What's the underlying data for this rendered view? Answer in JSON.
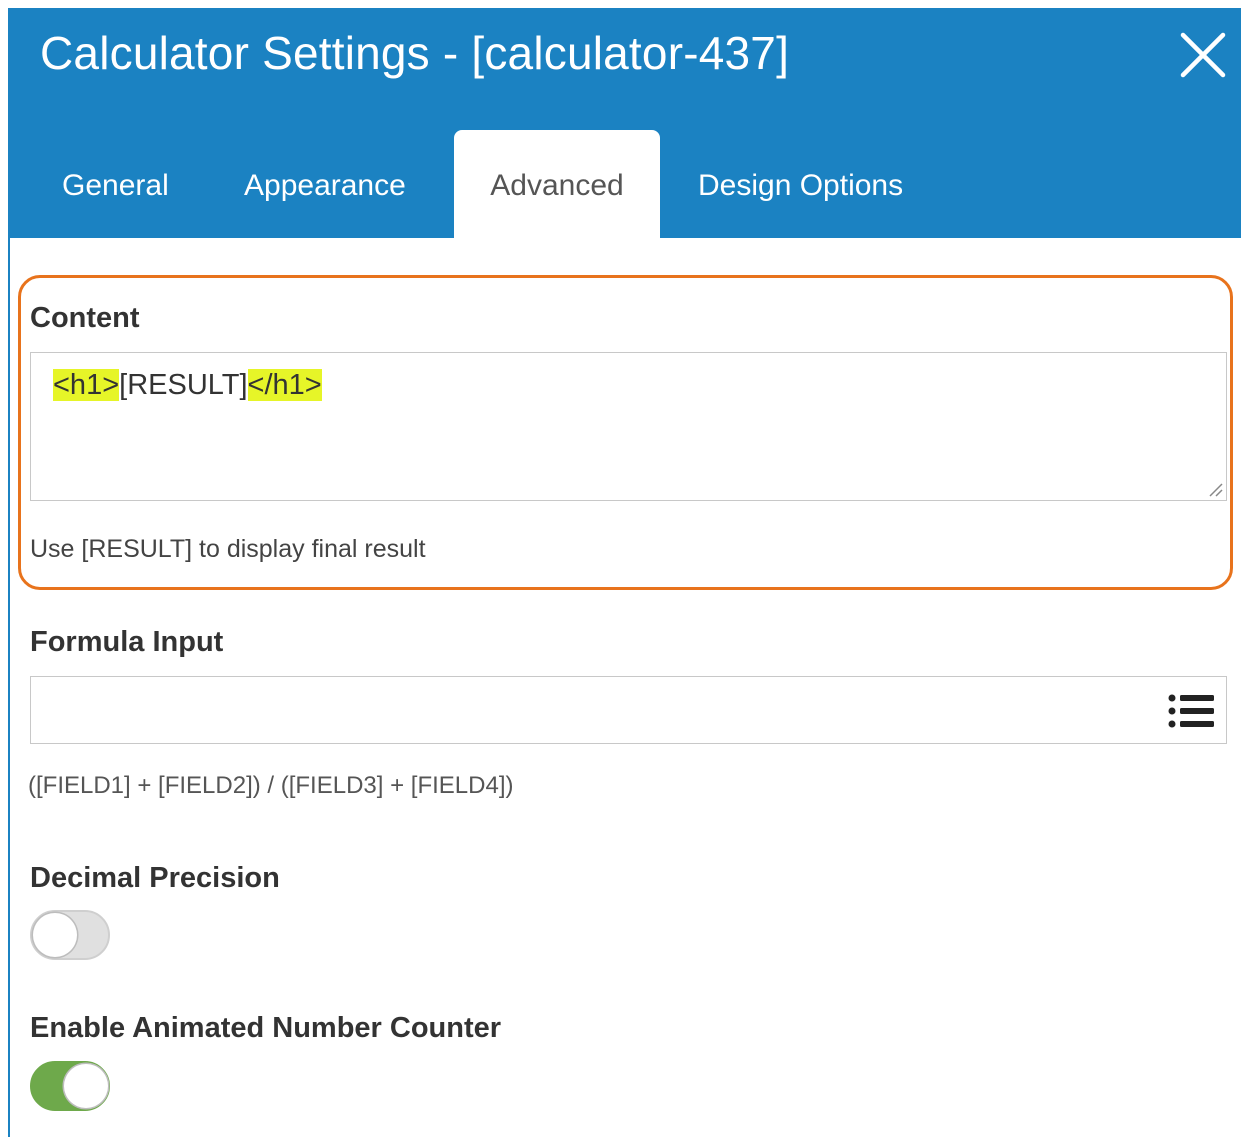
{
  "dialog": {
    "title": "Calculator Settings - [calculator-437]",
    "tabs": [
      {
        "label": "General"
      },
      {
        "label": "Appearance"
      },
      {
        "label": "Advanced",
        "active": true
      },
      {
        "label": "Design Options"
      }
    ]
  },
  "content_field": {
    "label": "Content",
    "value_open_tag": "<h1>",
    "value_placeholder": "[RESULT]",
    "value_close_tag": "</h1>",
    "hint": "Use [RESULT] to display final result"
  },
  "formula_field": {
    "label": "Formula Input",
    "value": "",
    "hint": "([FIELD1] + [FIELD2]) / ([FIELD3] + [FIELD4])"
  },
  "decimal_precision": {
    "label": "Decimal Precision",
    "enabled": false
  },
  "animated_counter": {
    "label": "Enable Animated Number Counter",
    "enabled": true
  },
  "colors": {
    "header_bg": "#1b82c2",
    "highlight_border": "#e8731c",
    "code_highlight": "#e6f528",
    "toggle_on": "#6ea94b"
  },
  "icons": [
    "close-icon",
    "list-icon",
    "resize-handle-icon"
  ]
}
